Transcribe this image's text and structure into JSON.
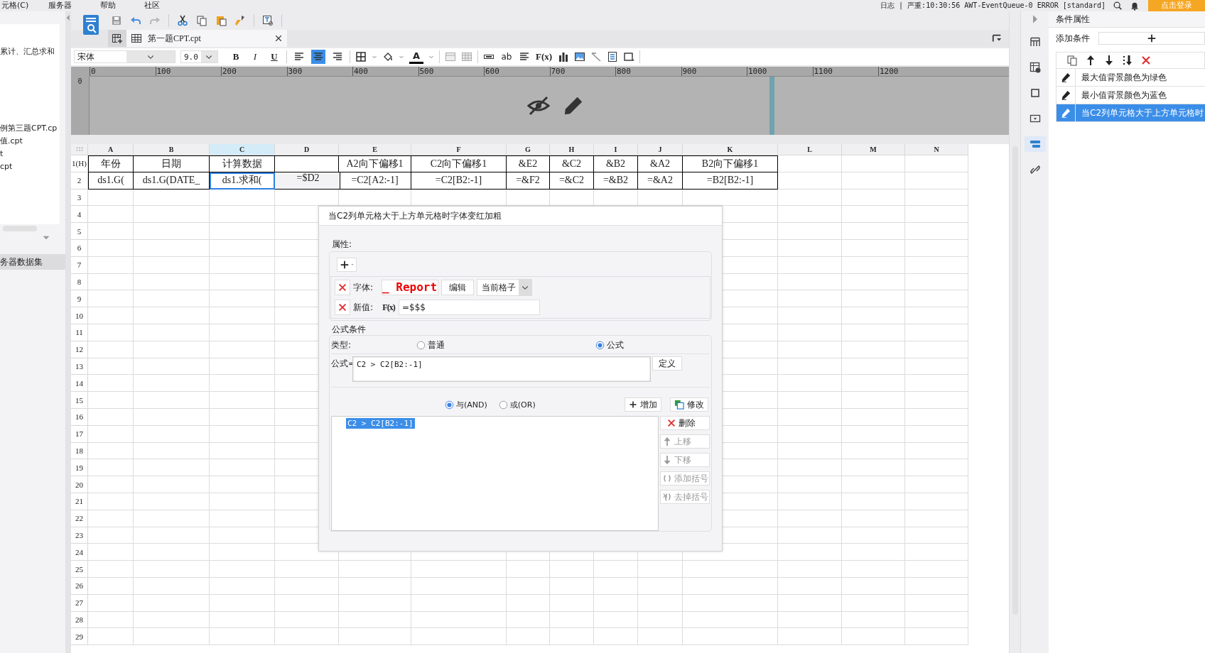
{
  "menu": [
    "元格(C)",
    "服务器",
    "帮助",
    "社区"
  ],
  "status_log": "日志 | 严重:10:30:56 AWT-EventQueue-0 ERROR [standard]",
  "login_button": "点击登录",
  "left_panel": {
    "items": [
      "累计、汇总求和",
      "例第三题CPT.cp",
      "值.cpt",
      "t",
      "cpt"
    ],
    "section": "务器数据集"
  },
  "tabs": [
    {
      "label": "第一题CPT.cpt",
      "selected": true
    }
  ],
  "format": {
    "font": "宋体",
    "size": "9.0",
    "bold": "B",
    "italic": "I",
    "underline": "U",
    "align": [
      {
        "selected": false
      },
      {
        "selected": true
      },
      {
        "selected": false
      }
    ],
    "font_color": "A",
    "text_tool": "ab",
    "formula_tool": "F(x)"
  },
  "ruler": {
    "ticks": [
      "0",
      "100",
      "200",
      "300",
      "400",
      "500",
      "600",
      "700",
      "800",
      "900",
      "1000",
      "1100",
      "1200"
    ],
    "vertical_tick": "0"
  },
  "sheet": {
    "columns": [
      {
        "label": "A",
        "selected": false
      },
      {
        "label": "B",
        "selected": false
      },
      {
        "label": "C",
        "selected": true
      },
      {
        "label": "D",
        "selected": false
      },
      {
        "label": "E",
        "selected": false
      },
      {
        "label": "F",
        "selected": false
      },
      {
        "label": "G",
        "selected": false
      },
      {
        "label": "H",
        "selected": false
      },
      {
        "label": "I",
        "selected": false
      },
      {
        "label": "J",
        "selected": false
      },
      {
        "label": "K",
        "selected": false
      },
      {
        "label": "L",
        "selected": false
      },
      {
        "label": "M",
        "selected": false
      },
      {
        "label": "N",
        "selected": false
      }
    ],
    "rows": [
      {
        "label": "1(H)",
        "cells": [
          {
            "text": "年份",
            "selected": false
          },
          {
            "text": "日期",
            "selected": false
          },
          {
            "text": "计算数据",
            "selected": false
          },
          {
            "selected": false
          },
          {
            "text": "A2向下偏移1",
            "selected": false
          },
          {
            "text": "C2向下偏移1",
            "selected": false
          },
          {
            "text": "&E2",
            "selected": false
          },
          {
            "text": "&C2",
            "selected": false
          },
          {
            "text": "&B2",
            "selected": false
          },
          {
            "text": "&A2",
            "selected": false
          },
          {
            "text": "B2向下偏移1",
            "selected": false
          }
        ]
      },
      {
        "label": "2",
        "cells": [
          {
            "text": "ds1.G(",
            "selected": false
          },
          {
            "text": "ds1.G(DATE_",
            "selected": false
          },
          {
            "text": "ds1.求和(",
            "selected": true
          },
          {
            "text": "=$D2",
            "selected": false
          },
          {
            "text": "=C2[A2:-1]",
            "selected": false
          },
          {
            "text": "=C2[B2:-1]",
            "selected": false
          },
          {
            "text": "=&F2",
            "selected": false
          },
          {
            "text": "=&C2",
            "selected": false
          },
          {
            "text": "=&B2",
            "selected": false
          },
          {
            "text": "=&A2",
            "selected": false
          },
          {
            "text": "=B2[B2:-1]",
            "selected": false
          }
        ]
      }
    ],
    "row_numbers": [
      "3",
      "4",
      "5",
      "6",
      "7",
      "8",
      "9",
      "10",
      "11",
      "12",
      "13",
      "14",
      "15",
      "16",
      "17",
      "18",
      "19",
      "20",
      "21",
      "22",
      "23",
      "24",
      "25",
      "26",
      "27",
      "28",
      "29"
    ]
  },
  "dialog": {
    "title": "当C2列单元格大于上方单元格时字体变红加粗",
    "properties_label": "属性:",
    "properties": [
      {
        "kind": "font",
        "label": "字体:",
        "preview": "_ Report",
        "button": "编辑",
        "scope": "当前格子"
      },
      {
        "kind": "value",
        "label": "新值:",
        "formula_icon": "F(x)",
        "value": "=$$$"
      }
    ],
    "formula_section": "公式条件",
    "type_label": "类型:",
    "types": [
      {
        "label": "普通",
        "selected": false
      },
      {
        "label": "公式",
        "selected": true
      }
    ],
    "formula_label": "公式=",
    "formula": "C2 > C2[B2:-1]",
    "define_button": "定义",
    "logic": [
      {
        "label": "与(AND)",
        "selected": true
      },
      {
        "label": "或(OR)",
        "selected": false
      }
    ],
    "add_button": "增加",
    "modify_button": "修改",
    "conditions": [
      {
        "text": "C2 > C2[B2:-1]",
        "selected": true
      }
    ],
    "side_buttons": [
      {
        "kind": "delete",
        "label": "删除",
        "disabled": false
      },
      {
        "kind": "up",
        "label": "上移",
        "disabled": true
      },
      {
        "kind": "down",
        "label": "下移",
        "disabled": true
      },
      {
        "kind": "add-bracket",
        "label": "添加括号",
        "disabled": true
      },
      {
        "kind": "remove-bracket",
        "label": "去掉括号",
        "disabled": true
      }
    ]
  },
  "right_panel": {
    "title": "条件属性",
    "add_label": "添加条件",
    "conditions": [
      {
        "text": "最大值背景颜色为绿色",
        "selected": false
      },
      {
        "text": "最小值背景颜色为蓝色",
        "selected": false
      },
      {
        "text": "当C2列单元格大于上方单元格时",
        "selected": true
      }
    ]
  }
}
